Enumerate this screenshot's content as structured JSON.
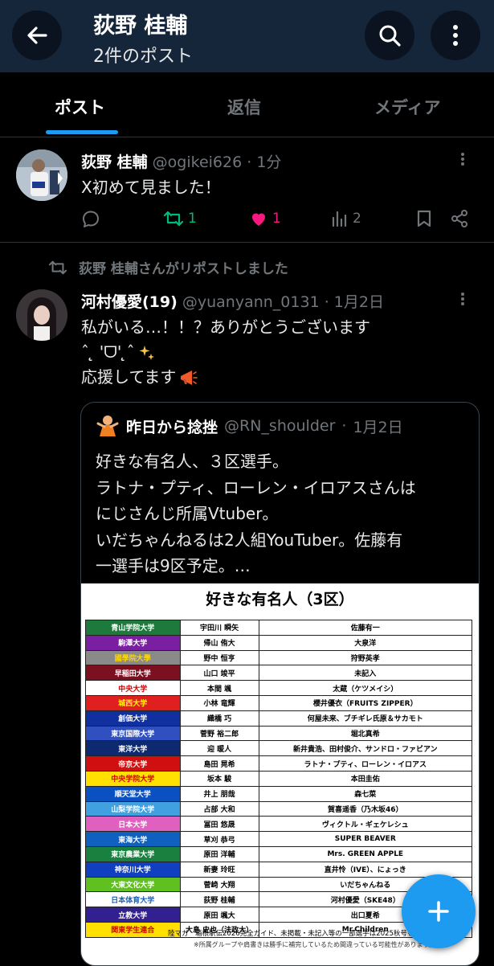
{
  "header": {
    "title": "荻野 桂輔",
    "subtitle": "2件のポスト"
  },
  "tabs": [
    {
      "label": "ポスト"
    },
    {
      "label": "返信"
    },
    {
      "label": "メディア"
    }
  ],
  "post1": {
    "name": "荻野 桂輔",
    "handle": "@ogikei626",
    "time": "1分",
    "text": "X初めて見ました！",
    "retweets": "1",
    "likes": "1",
    "views": "2"
  },
  "repost_banner": "荻野 桂輔さんがリポストしました",
  "post2": {
    "name": "河村優愛(19)",
    "handle": "@yuanyann_0131",
    "time": "1月2日",
    "line1": "私がいる…！！？ありがとうございます",
    "line2": "ˆ ̨̨̨ 'ᗜ' ̨̨̨ˆ",
    "line3": "応援してます",
    "quote": {
      "name": "昨日から捻挫",
      "handle": "@RN_shoulder",
      "time": "1月2日",
      "lines": [
        "好きな有名人、３区選手。",
        "ラトナ・プティ、ローレン・イロアスさんは",
        "にじさんじ所属Vtuber。",
        "いだちゃんねるは2人組YouTuber。佐藤有",
        "一選手は9区予定。…"
      ],
      "table": {
        "title": "好きな有名人（3区）",
        "rows": [
          {
            "team": "青山学院大学",
            "player": "宇田川 瞬矢",
            "celeb": "佐藤有一",
            "color": "#1e7a3c",
            "tc": "#ffffff"
          },
          {
            "team": "駒澤大学",
            "player": "帰山 侑大",
            "celeb": "大泉洋",
            "color": "#7a1fa2",
            "tc": "#ffffff"
          },
          {
            "team": "國學院大學",
            "player": "野中 恒亨",
            "celeb": "狩野英孝",
            "color": "#8a8a8a",
            "tc": "#ffd700"
          },
          {
            "team": "早稲田大学",
            "player": "山口 竣平",
            "celeb": "未記入",
            "color": "#7a1020",
            "tc": "#ffffff"
          },
          {
            "team": "中央大学",
            "player": "本間 颯",
            "celeb": "太蔵（ケツメイシ）",
            "color": "#ffffff",
            "tc": "#d00000"
          },
          {
            "team": "城西大学",
            "player": "小林 竜輝",
            "celeb": "櫻井優衣（FRUITS ZIPPER）",
            "color": "#e02020",
            "tc": "#ffff00"
          },
          {
            "team": "創価大学",
            "player": "織橋 巧",
            "celeb": "何屋未来、ブチギレ氏原＆サカモト",
            "color": "#1030a0",
            "tc": "#ffffff"
          },
          {
            "team": "東京国際大学",
            "player": "菅野 裕二郎",
            "celeb": "堀北真希",
            "color": "#3050c0",
            "tc": "#ffffff"
          },
          {
            "team": "東洋大学",
            "player": "迎 暖人",
            "celeb": "新井貴浩、田村俊介、サンドロ・ファビアン",
            "color": "#0d2a70",
            "tc": "#ffffff"
          },
          {
            "team": "帝京大学",
            "player": "島田 晃希",
            "celeb": "ラトナ・プティ、ローレン・イロアス",
            "color": "#d01010",
            "tc": "#ffffff"
          },
          {
            "team": "中央学院大学",
            "player": "坂本 駿",
            "celeb": "本田圭佑",
            "color": "#ffe000",
            "tc": "#d00000"
          },
          {
            "team": "順天堂大学",
            "player": "井上 朋哉",
            "celeb": "森七菜",
            "color": "#0a50c0",
            "tc": "#ffffff"
          },
          {
            "team": "山梨学院大学",
            "player": "占部 大和",
            "celeb": "賀喜遥香（乃木坂46）",
            "color": "#40a0e0",
            "tc": "#ffffff"
          },
          {
            "team": "日本大学",
            "player": "冨田 悠晟",
            "celeb": "ヴィクトル・ギェケレシュ",
            "color": "#e060c0",
            "tc": "#ffffff"
          },
          {
            "team": "東海大学",
            "player": "草刈 恭弓",
            "celeb": "SUPER BEAVER",
            "color": "#1060c0",
            "tc": "#ffffff"
          },
          {
            "team": "東京農業大学",
            "player": "原田 洋輔",
            "celeb": "Mrs. GREEN APPLE",
            "color": "#1a8040",
            "tc": "#ffffff"
          },
          {
            "team": "神奈川大学",
            "player": "新妻 玲旺",
            "celeb": "直井怜（IVE）、にょっき",
            "color": "#1040c0",
            "tc": "#ffffff"
          },
          {
            "team": "大東文化大学",
            "player": "菅崎 大翔",
            "celeb": "いだちゃんねる",
            "color": "#60c020",
            "tc": "#ffffff"
          },
          {
            "team": "日本体育大学",
            "player": "荻野 桂輔",
            "celeb": "河村優愛（SKE48）",
            "color": "#ffffff",
            "tc": "#1060c0"
          },
          {
            "team": "立教大学",
            "player": "原田 颯大",
            "celeb": "出口夏希",
            "color": "#302090",
            "tc": "#ffffff"
          },
          {
            "team": "関東学生連合",
            "player": "大島 史也（法政大）",
            "celeb": "Mr.Children",
            "color": "#ffe000",
            "tc": "#d00000"
          }
        ],
        "footer1": "陸マガ　箱根駅伝2026完全ガイド、未掲載・未記入等の一部選手は2025秋号を参照より",
        "footer2": "※所属グループや肩書きは勝手に補完しているため間違っている可能性があります。"
      }
    }
  }
}
